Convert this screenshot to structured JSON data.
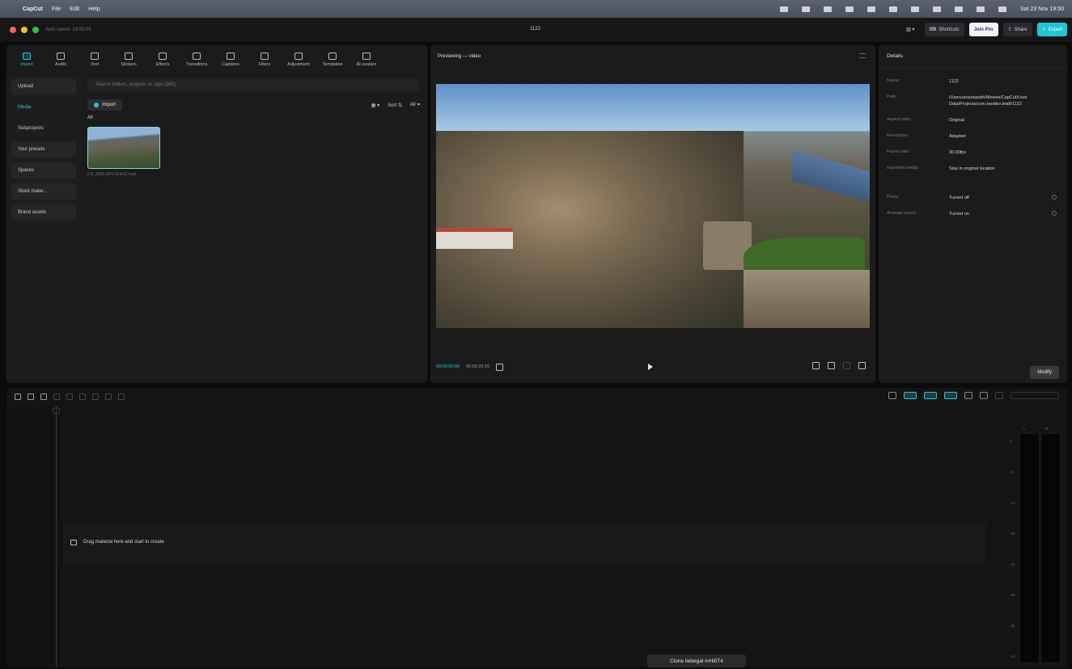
{
  "menubar": {
    "app": "CapCut",
    "items": [
      "File",
      "Edit",
      "Help"
    ],
    "clock": "Sat 23 Nov 19:50"
  },
  "titlebar": {
    "autosave": "Auto saved: 19:50:05",
    "project_title": "1122",
    "shortcuts_label": "Shortcuts",
    "join_pro_label": "Join Pro",
    "share_label": "Share",
    "export_label": "Export"
  },
  "toolbar": {
    "tools": [
      {
        "label": "Import",
        "icon": "import-icon",
        "active": true
      },
      {
        "label": "Audio",
        "icon": "audio-icon"
      },
      {
        "label": "Text",
        "icon": "text-icon"
      },
      {
        "label": "Stickers",
        "icon": "stickers-icon"
      },
      {
        "label": "Effects",
        "icon": "effects-icon"
      },
      {
        "label": "Transitions",
        "icon": "transitions-icon"
      },
      {
        "label": "Captions",
        "icon": "captions-icon"
      },
      {
        "label": "Filters",
        "icon": "filters-icon"
      },
      {
        "label": "Adjustment",
        "icon": "adjustment-icon"
      },
      {
        "label": "Templates",
        "icon": "templates-icon"
      },
      {
        "label": "AI avatars",
        "icon": "ai-avatars-icon"
      }
    ]
  },
  "media": {
    "side": [
      "Upload",
      "Media",
      "Subprojects",
      "Your presets",
      "Spaces",
      "Stock mater...",
      "Brand assets"
    ],
    "search_placeholder": "Search folders, projects or clips (⌘E)",
    "import_label": "Import",
    "sort_label": "Sort",
    "all_filter": "All",
    "all_label": "All",
    "clip_name": "DJI_0001.MP4 (Edit1).mp4"
  },
  "preview": {
    "header": "Previewing — video",
    "timecode_current": "00:00:00:00",
    "timecode_total": "00:00:20:16"
  },
  "details": {
    "header": "Details",
    "rows": [
      {
        "label": "Name:",
        "value": "1122"
      },
      {
        "label": "Path:",
        "value": "/Users/aneelaseth/Movies/CapCut/User Data/Projects/com.lveditor.draft/1122"
      },
      {
        "label": "Aspect ratio:",
        "value": "Original"
      },
      {
        "label": "Resolution:",
        "value": "Adapted"
      },
      {
        "label": "Frame rate:",
        "value": "30.00fps"
      },
      {
        "label": "Imported media:",
        "value": "Stay in original location"
      },
      {
        "label": "Proxy:",
        "value": "Turned off"
      },
      {
        "label": "Arrange layers:",
        "value": "Turned on"
      }
    ],
    "modify_label": "Modify"
  },
  "timeline": {
    "drop_text": "Drag material here and start to create",
    "meter_ticks": [
      "0",
      "-6",
      "-12",
      "-18",
      "-24",
      "-30",
      "-36",
      "-42"
    ],
    "meter_heads": [
      "L",
      "R"
    ]
  },
  "tooltip": "Clone liebegal mHi5T4"
}
